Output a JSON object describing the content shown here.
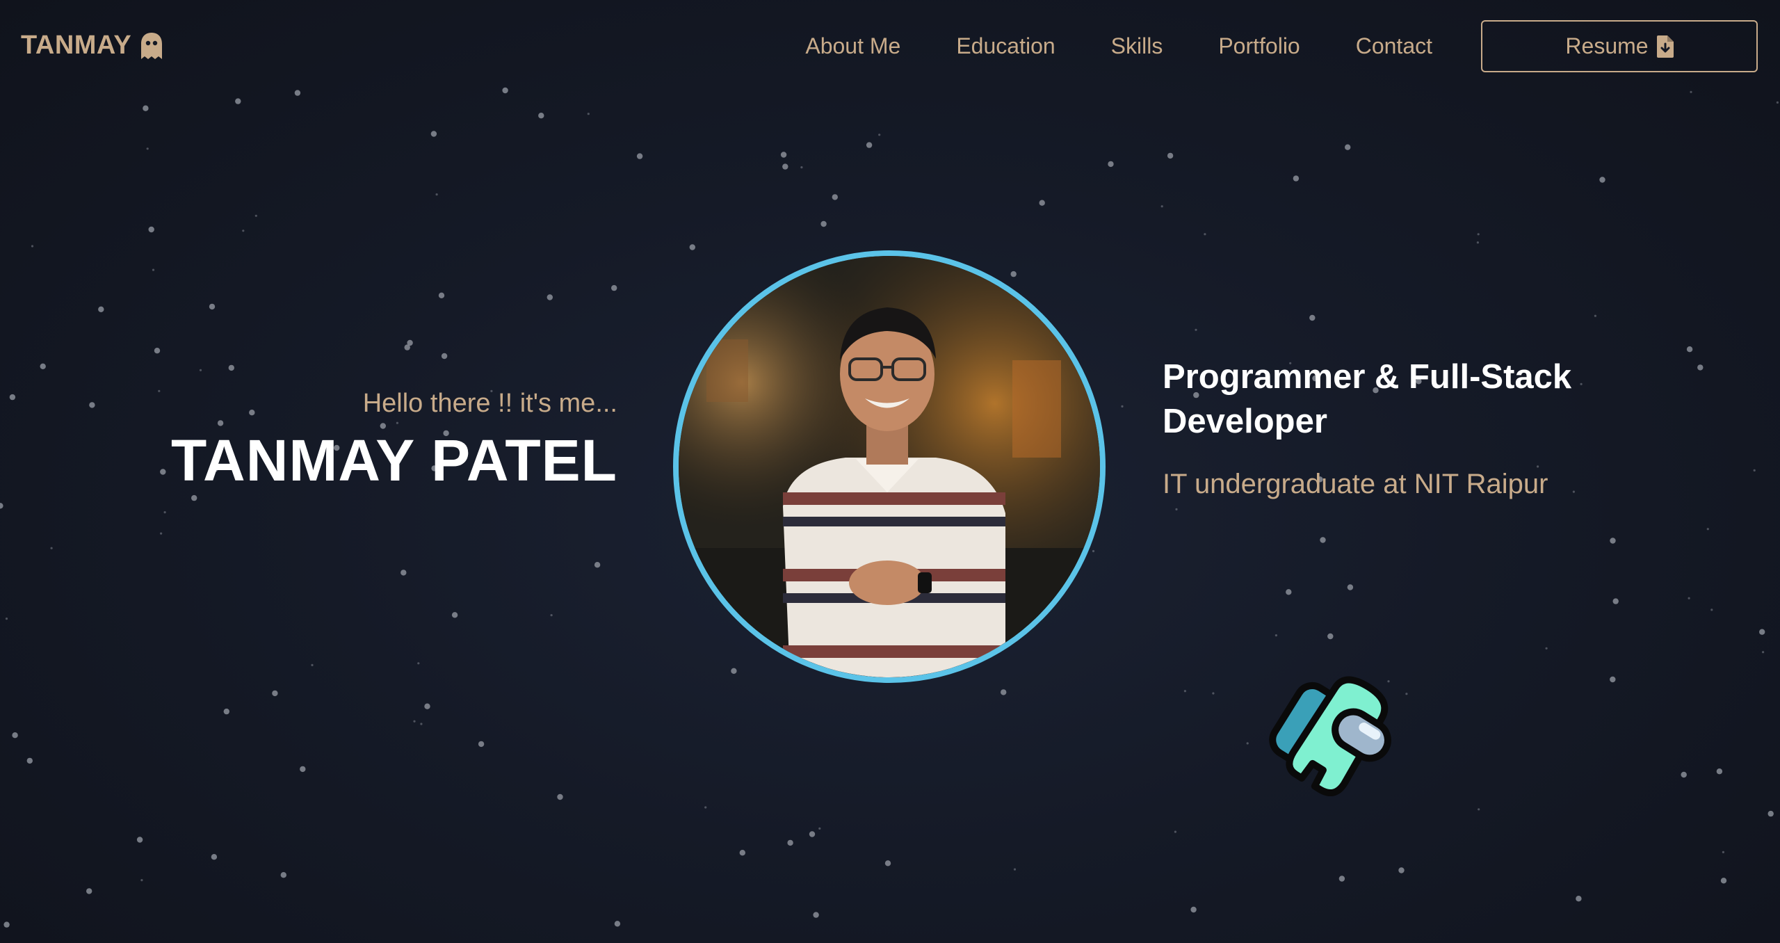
{
  "navbar": {
    "logo_text": "TANMAY",
    "logo_icon": "ghost-icon",
    "links": [
      "About Me",
      "Education",
      "Skills",
      "Portfolio",
      "Contact"
    ],
    "resume_label": "Resume",
    "resume_icon": "file-download-icon"
  },
  "hero": {
    "greeting": "Hello there !! it's me...",
    "name": "TANMAY PATEL",
    "role": "Programmer & Full-Stack Developer",
    "subtitle": "IT undergraduate at NIT Raipur",
    "profile_image": "profile-photo",
    "decoration_icon": "astronaut-icon"
  },
  "colors": {
    "background": "#121520",
    "accent": "#c8ab8a",
    "ring": "#5bc3e8",
    "heading": "#ffffff",
    "star": "#8a8e98"
  }
}
